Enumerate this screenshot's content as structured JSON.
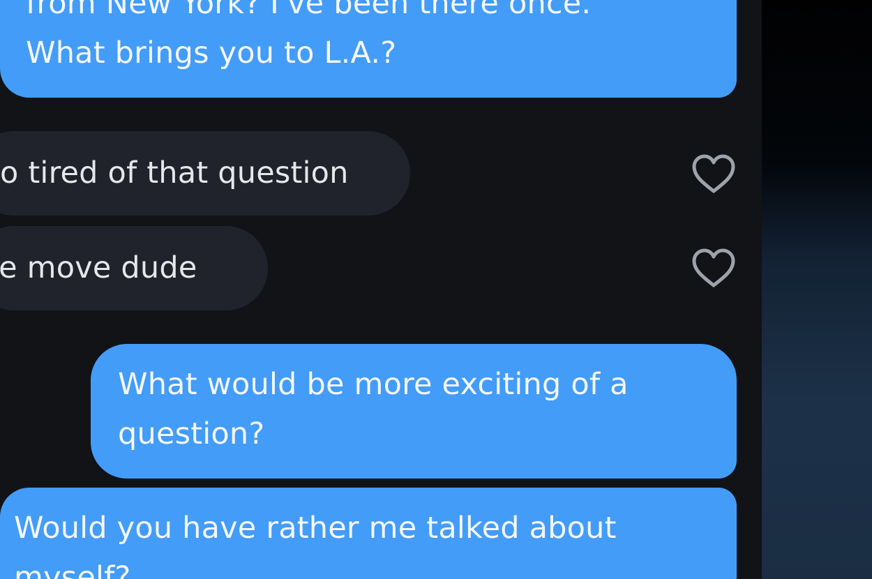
{
  "conversation": {
    "messages": [
      {
        "direction": "sent",
        "lines": [
          "from New York? I've been there once.",
          "What brings you to L.A.?"
        ]
      },
      {
        "direction": "received",
        "lines": [
          "o tired of that question"
        ],
        "heart_icon": "heart-outline-icon"
      },
      {
        "direction": "received",
        "lines": [
          "le move dude"
        ],
        "heart_icon": "heart-outline-icon"
      },
      {
        "direction": "sent",
        "lines": [
          "What would be more exciting of a",
          "question?"
        ]
      },
      {
        "direction": "sent",
        "lines": [
          "Would you have rather me talked about",
          "myself?"
        ]
      }
    ]
  },
  "colors": {
    "sent_bubble": "#439cf7",
    "received_bubble": "#20232b",
    "chat_background": "#111317",
    "heart_outline": "#9ea3ab"
  }
}
